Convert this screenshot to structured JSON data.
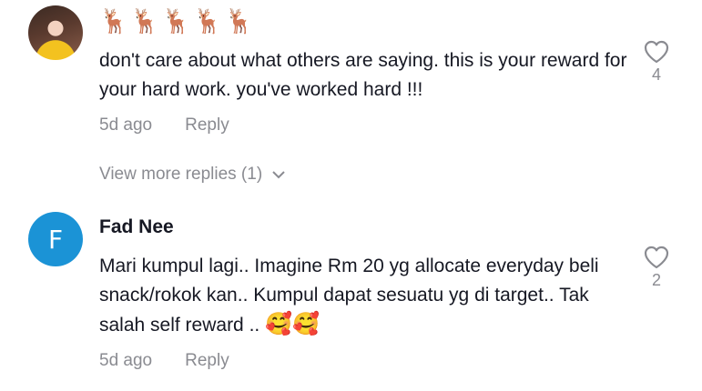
{
  "comments": [
    {
      "deer_emojis": "🦌🦌🦌🦌🦌",
      "text": "don't care about what others are saying. this is your reward for your hard work. you've worked hard !!!",
      "time": "5d ago",
      "reply_label": "Reply",
      "likes": "4"
    },
    {
      "avatar_letter": "F",
      "username": "Fad Nee",
      "text": "Mari kumpul lagi.. Imagine Rm 20 yg allocate everyday beli snack/rokok kan.. Kumpul dapat sesuatu yg di target.. Tak salah self reward ..",
      "emojis": "🥰🥰",
      "time": "5d ago",
      "reply_label": "Reply",
      "likes": "2"
    }
  ],
  "view_more_replies": "View more replies (1)",
  "colors": {
    "text": "#161823",
    "muted": "#8a8b91",
    "avatar_blue": "#1b93d6"
  }
}
